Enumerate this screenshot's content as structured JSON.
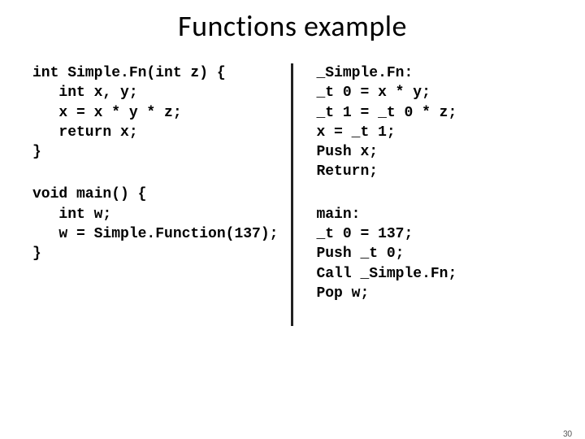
{
  "title": "Functions example",
  "left": {
    "block1": "int Simple.Fn(int z) {\n   int x, y;\n   x = x * y * z;\n   return x;\n}",
    "block2": "void main() {\n   int w;\n   w = Simple.Function(137);\n}"
  },
  "right": {
    "block1": "_Simple.Fn:\n_t 0 = x * y;\n_t 1 = _t 0 * z;\nx = _t 1;\nPush x;\nReturn;",
    "block2": "main:\n_t 0 = 137;\nPush _t 0;\nCall _Simple.Fn;\nPop w;"
  },
  "page_number": "30"
}
